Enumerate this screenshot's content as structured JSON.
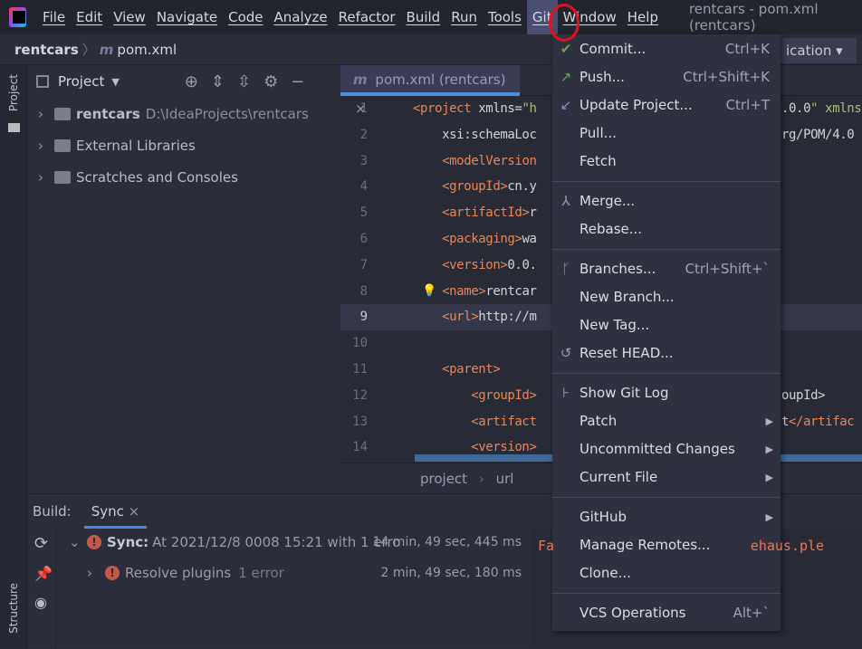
{
  "menubar": {
    "items": [
      "File",
      "Edit",
      "View",
      "Navigate",
      "Code",
      "Analyze",
      "Refactor",
      "Build",
      "Run",
      "Tools",
      "Git",
      "Window",
      "Help"
    ],
    "active": "Git",
    "window_title": "rentcars - pom.xml (rentcars)"
  },
  "navbar": {
    "project": "rentcars",
    "file": "pom.xml",
    "run_config": "ication"
  },
  "left_strip": {
    "project_tab": "Project",
    "structure_tab": "Structure"
  },
  "project_panel": {
    "title": "Project",
    "items": [
      {
        "name": "rentcars",
        "hint": "D:\\IdeaProjects\\rentcars"
      },
      {
        "name": "External Libraries",
        "hint": ""
      },
      {
        "name": "Scratches and Consoles",
        "hint": ""
      }
    ]
  },
  "editor": {
    "tab": "pom.xml (rentcars)",
    "lines": [
      {
        "n": "1",
        "left": "<project xmlns=\"h",
        "right": ".0.0\" xmlns"
      },
      {
        "n": "2",
        "left": "    xsi:schemaLoc",
        "right": "rg/POM/4.0"
      },
      {
        "n": "3",
        "left": "    <modelVersion",
        "right": ""
      },
      {
        "n": "4",
        "left": "    <groupId>cn.y",
        "right": ""
      },
      {
        "n": "5",
        "left": "    <artifactId>r",
        "right": ""
      },
      {
        "n": "6",
        "left": "    <packaging>wa",
        "right": ""
      },
      {
        "n": "7",
        "left": "    <version>0.0.",
        "right": ""
      },
      {
        "n": "8",
        "left": "    <name>rentcar",
        "right": ""
      },
      {
        "n": "9",
        "left": "    <url>http://m",
        "right": ""
      },
      {
        "n": "10",
        "left": "",
        "right": ""
      },
      {
        "n": "11",
        "left": "    <parent>",
        "right": ""
      },
      {
        "n": "12",
        "left": "        <groupId>",
        "right": "oupId>"
      },
      {
        "n": "13",
        "left": "        <artifact",
        "right": "t</artifac"
      },
      {
        "n": "14",
        "left": "        <version>",
        "right": ""
      }
    ],
    "current_line": "9",
    "breadcrumb": [
      "project",
      "url"
    ]
  },
  "build": {
    "label": "Build:",
    "tab": "Sync",
    "rows": [
      {
        "bold": "Sync:",
        "text": "At 2021/12/8 0008 15:21 with 1 erro",
        "time": "14 min, 49 sec, 445 ms"
      },
      {
        "bold": "",
        "text": "Resolve plugins",
        "hint": "1 error",
        "time": "2 min, 49 sec, 180 ms"
      }
    ],
    "console": "Fa                        ehaus.ple"
  },
  "git_menu": {
    "groups": [
      [
        {
          "label": "Commit...",
          "shortcut": "Ctrl+K",
          "icon": "check-icon"
        },
        {
          "label": "Push...",
          "shortcut": "Ctrl+Shift+K",
          "icon": "push-arrow-icon"
        },
        {
          "label": "Update Project...",
          "shortcut": "Ctrl+T",
          "icon": "update-arrow-icon"
        },
        {
          "label": "Pull...",
          "shortcut": ""
        },
        {
          "label": "Fetch",
          "shortcut": ""
        }
      ],
      [
        {
          "label": "Merge...",
          "shortcut": "",
          "icon": "merge-icon"
        },
        {
          "label": "Rebase...",
          "shortcut": ""
        }
      ],
      [
        {
          "label": "Branches...",
          "shortcut": "Ctrl+Shift+`",
          "icon": "branch-icon"
        },
        {
          "label": "New Branch...",
          "shortcut": ""
        },
        {
          "label": "New Tag...",
          "shortcut": ""
        },
        {
          "label": "Reset HEAD...",
          "shortcut": "",
          "icon": "undo-icon"
        }
      ],
      [
        {
          "label": "Show Git Log",
          "shortcut": "",
          "icon": "git-log-icon"
        },
        {
          "label": "Patch",
          "submenu": true
        },
        {
          "label": "Uncommitted Changes",
          "submenu": true
        },
        {
          "label": "Current File",
          "submenu": true
        }
      ],
      [
        {
          "label": "GitHub",
          "submenu": true
        },
        {
          "label": "Manage Remotes..."
        },
        {
          "label": "Clone..."
        }
      ],
      [
        {
          "label": "VCS Operations",
          "shortcut": "Alt+`"
        }
      ]
    ]
  },
  "colors": {
    "accent": "#3d8fe6",
    "active_menu": "#4a4e70",
    "annotation": "#e0141c",
    "error": "#c4584a"
  }
}
